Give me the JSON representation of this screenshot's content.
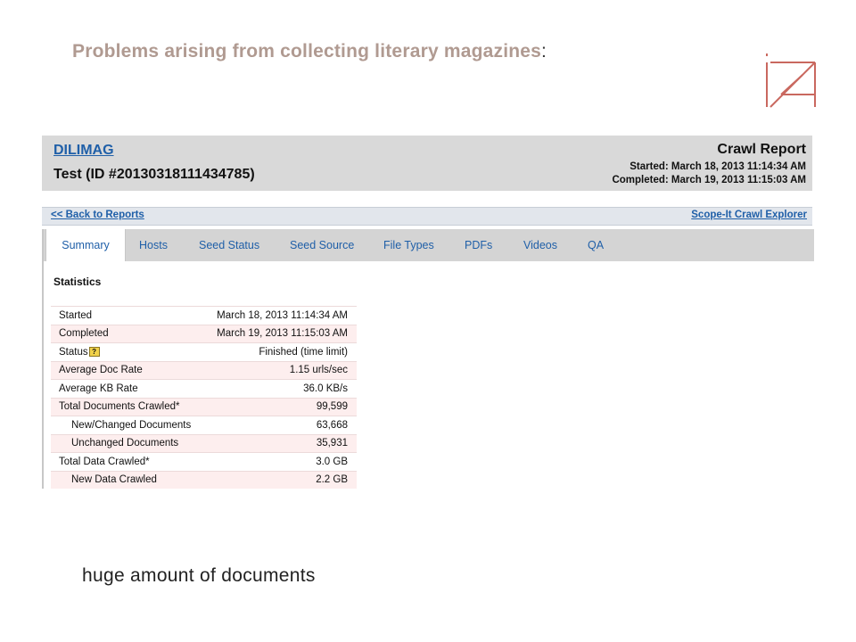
{
  "slide": {
    "title": "Problems arising from collecting literary magazines",
    "title_colon": ":",
    "caption": "huge amount of documents"
  },
  "report": {
    "site_name": "DILIMAG",
    "crawl_name": "Test (ID #20130318111434785)",
    "title": "Crawl Report",
    "started": "Started: March 18, 2013 11:14:34 AM",
    "completed": "Completed: March 19, 2013 11:15:03 AM",
    "back_link": "<< Back to Reports",
    "explorer_link": "Scope-It Crawl Explorer",
    "tabs": [
      {
        "label": "Summary"
      },
      {
        "label": "Hosts"
      },
      {
        "label": "Seed Status"
      },
      {
        "label": "Seed Source"
      },
      {
        "label": "File Types"
      },
      {
        "label": "PDFs"
      },
      {
        "label": "Videos"
      },
      {
        "label": "QA"
      }
    ],
    "active_tab": "Summary",
    "statistics_heading": "Statistics",
    "statistics": [
      {
        "label": "Started",
        "value": "March 18, 2013 11:14:34 AM"
      },
      {
        "label": "Completed",
        "value": "March 19, 2013 11:15:03 AM"
      },
      {
        "label": "Status",
        "value": "Finished (time limit)",
        "help_icon": "?"
      },
      {
        "label": "Average Doc Rate",
        "value": "1.15 urls/sec"
      },
      {
        "label": "Average KB Rate",
        "value": "36.0 KB/s"
      },
      {
        "label": "Total Documents Crawled*",
        "value": "99,599"
      },
      {
        "label": "New/Changed Documents",
        "value": "63,668"
      },
      {
        "label": "Unchanged Documents",
        "value": "35,931"
      },
      {
        "label": "Total Data Crawled*",
        "value": "3.0 GB"
      },
      {
        "label": "New Data Crawled",
        "value": "2.2 GB"
      }
    ]
  },
  "colors": {
    "title": "#b09a91",
    "link": "#1f5fa8",
    "logo": "#c9685f",
    "row_stripe": "#fdeeee"
  }
}
